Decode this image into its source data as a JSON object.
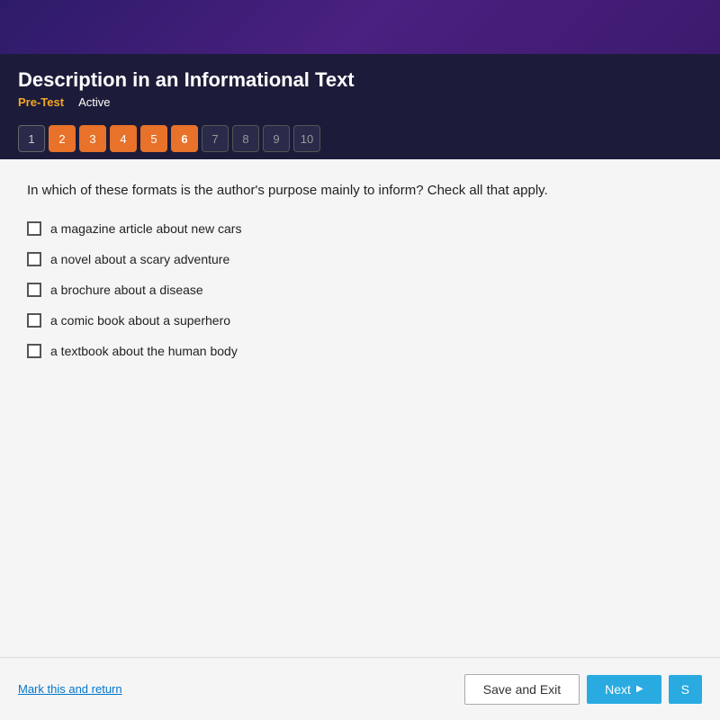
{
  "top_bar": {},
  "header": {
    "title": "Description in an Informational Text",
    "pre_test_label": "Pre-Test",
    "active_label": "Active"
  },
  "pagination": {
    "pages": [
      {
        "num": "1",
        "state": "available"
      },
      {
        "num": "2",
        "state": "completed"
      },
      {
        "num": "3",
        "state": "completed"
      },
      {
        "num": "4",
        "state": "completed"
      },
      {
        "num": "5",
        "state": "completed"
      },
      {
        "num": "6",
        "state": "active"
      },
      {
        "num": "7",
        "state": "disabled"
      },
      {
        "num": "8",
        "state": "disabled"
      },
      {
        "num": "9",
        "state": "disabled"
      },
      {
        "num": "10",
        "state": "disabled"
      }
    ]
  },
  "question": {
    "text": "In which of these formats is the author's purpose mainly to inform? Check all that apply.",
    "options": [
      {
        "id": "opt1",
        "label": "a magazine article about new cars",
        "checked": false
      },
      {
        "id": "opt2",
        "label": "a novel about a scary adventure",
        "checked": false
      },
      {
        "id": "opt3",
        "label": "a brochure about a disease",
        "checked": false
      },
      {
        "id": "opt4",
        "label": "a comic book about a superhero",
        "checked": false
      },
      {
        "id": "opt5",
        "label": "a textbook about the human body",
        "checked": false
      }
    ]
  },
  "footer": {
    "mark_return_label": "Mark this and return",
    "save_exit_label": "Save and Exit",
    "next_label": "Next",
    "skip_label": "S"
  }
}
